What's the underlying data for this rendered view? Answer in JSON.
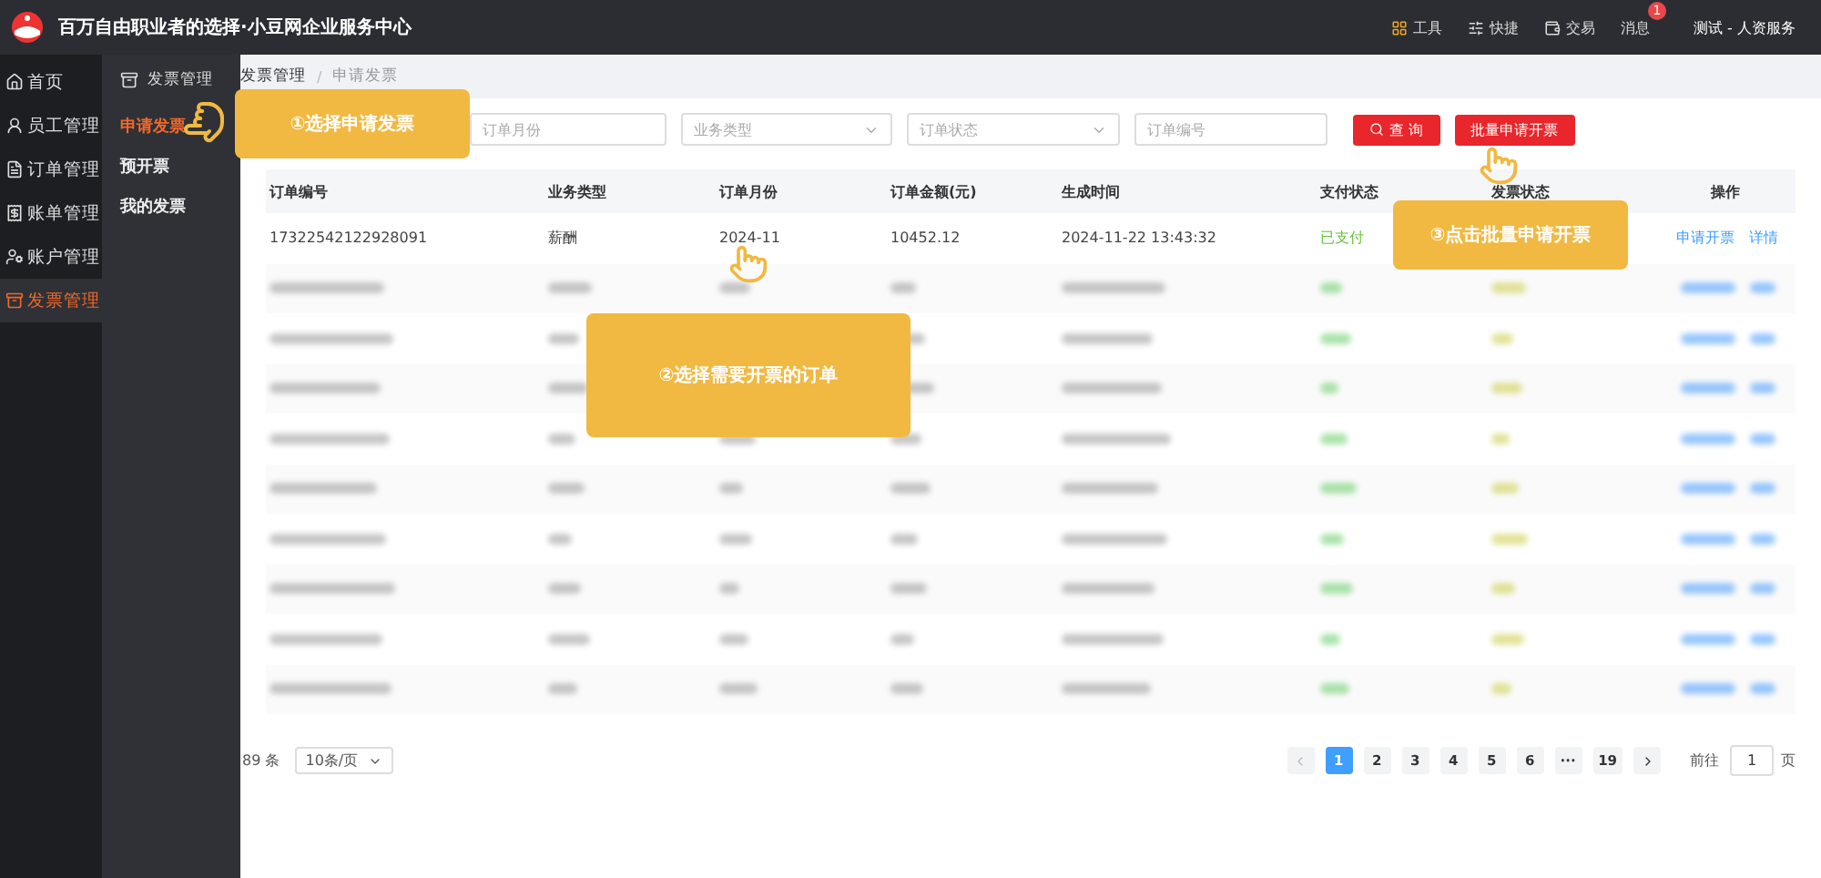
{
  "header": {
    "title": "百万自由职业者的选择·小豆网企业服务中心",
    "tools": [
      {
        "kind": "grid",
        "label": "工具"
      },
      {
        "kind": "sliders",
        "label": "快捷"
      },
      {
        "kind": "wallet",
        "label": "交易"
      },
      {
        "kind": "message",
        "label": "消息",
        "badge": "1"
      }
    ],
    "user": "测试 - 人资服务"
  },
  "sidebar": {
    "items": [
      {
        "kind": "home",
        "label": "首页",
        "selected": false
      },
      {
        "kind": "users",
        "label": "员工管理",
        "selected": false
      },
      {
        "kind": "order",
        "label": "订单管理",
        "selected": false
      },
      {
        "kind": "bill",
        "label": "账单管理",
        "selected": false
      },
      {
        "kind": "account",
        "label": "账户管理",
        "selected": false
      },
      {
        "kind": "invoice",
        "label": "发票管理",
        "selected": true
      }
    ]
  },
  "submenu": {
    "title": "发票管理",
    "items": [
      {
        "label": "申请发票",
        "selected": true
      },
      {
        "label": "预开票",
        "selected": false
      },
      {
        "label": "我的发票",
        "selected": false
      }
    ]
  },
  "breadcrumb": [
    "发票管理",
    "申请发票"
  ],
  "breadcrumb_separator": "/",
  "filters": [
    {
      "kind": "input",
      "placeholder": "订单月份"
    },
    {
      "kind": "select",
      "placeholder": "业务类型"
    },
    {
      "kind": "select",
      "placeholder": "订单状态"
    },
    {
      "kind": "input",
      "placeholder": "订单编号"
    }
  ],
  "buttons": [
    {
      "kind": "search",
      "label": "查 询"
    },
    {
      "kind": "plain",
      "label": "批量申请开票"
    }
  ],
  "table": {
    "columns": [
      "订单编号",
      "业务类型",
      "订单月份",
      "订单金额(元)",
      "生成时间",
      "支付状态",
      "发票状态",
      "操作"
    ],
    "rows": [
      {
        "kind": "order",
        "cells": [
          "17322542122928091",
          "薪酬",
          "2024-11",
          "10452.12",
          "2024-11-22 13:43:32",
          "已支付"
        ],
        "actions": [
          "申请开票",
          "详情"
        ]
      },
      {
        "kind": "blurred"
      },
      {
        "kind": "blurred"
      },
      {
        "kind": "blurred"
      },
      {
        "kind": "blurred"
      },
      {
        "kind": "blurred"
      },
      {
        "kind": "blurred"
      },
      {
        "kind": "blurred"
      },
      {
        "kind": "blurred"
      },
      {
        "kind": "blurred"
      }
    ]
  },
  "pagination": {
    "total": "89 条",
    "page_size": "10条/页",
    "pages": [
      {
        "label": "1",
        "selected": true
      },
      {
        "label": "2",
        "selected": false
      },
      {
        "label": "3",
        "selected": false
      },
      {
        "label": "4",
        "selected": false
      },
      {
        "label": "5",
        "selected": false
      },
      {
        "label": "6",
        "selected": false
      },
      {
        "label": "···",
        "selected": false
      },
      {
        "label": "19",
        "selected": false
      }
    ],
    "goto_label": "前往",
    "goto_value": "1",
    "goto_suffix": "页"
  },
  "callouts": [
    "①选择申请发票",
    "②选择需要开票的订单",
    "③点击批量申请开票"
  ]
}
